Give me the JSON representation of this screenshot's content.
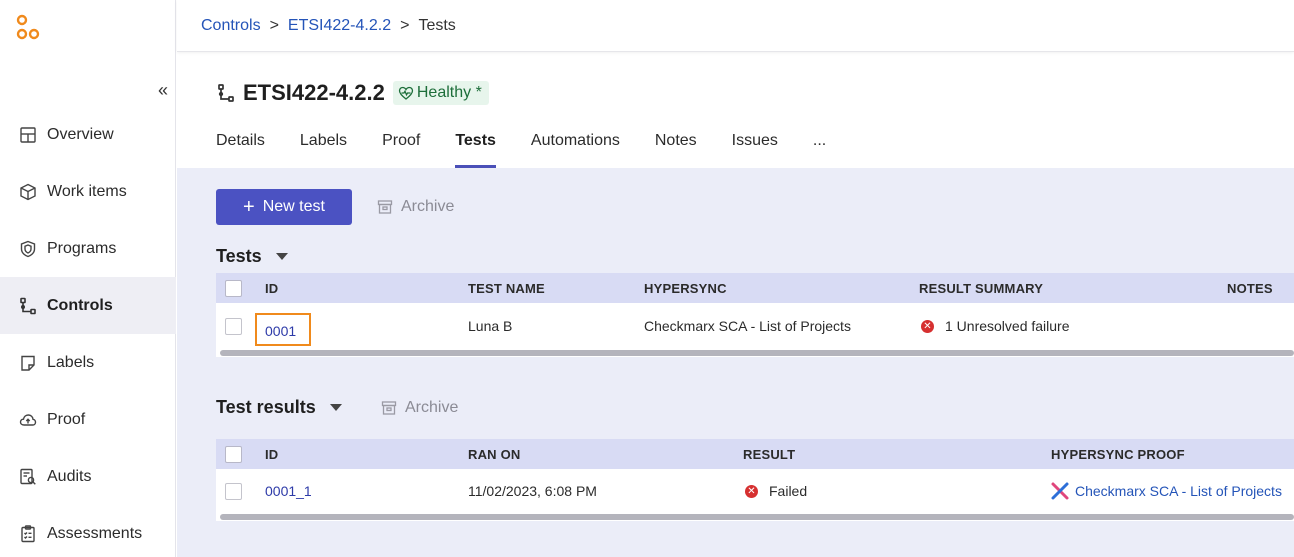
{
  "sidebar": {
    "collapse_label": "«",
    "items": [
      {
        "label": "Overview",
        "icon": "overview-icon"
      },
      {
        "label": "Work items",
        "icon": "box-icon"
      },
      {
        "label": "Programs",
        "icon": "shield-icon"
      },
      {
        "label": "Controls",
        "icon": "controls-icon",
        "active": true
      },
      {
        "label": "Labels",
        "icon": "label-icon"
      },
      {
        "label": "Proof",
        "icon": "cloud-icon"
      },
      {
        "label": "Audits",
        "icon": "audits-icon"
      },
      {
        "label": "Assessments",
        "icon": "clipboard-icon"
      }
    ]
  },
  "breadcrumb": {
    "items": [
      "Controls",
      "ETSI422-4.2.2"
    ],
    "separator": ">",
    "current": "Tests"
  },
  "header": {
    "title": "ETSI422-4.2.2",
    "status": "Healthy *"
  },
  "tabs": [
    "Details",
    "Labels",
    "Proof",
    "Tests",
    "Automations",
    "Notes",
    "Issues",
    "..."
  ],
  "active_tab": "Tests",
  "toolbar": {
    "new_test_label": "New test",
    "archive_label": "Archive"
  },
  "tests": {
    "title": "Tests",
    "archive_label": "Archive",
    "columns": [
      "ID",
      "TEST NAME",
      "HYPERSYNC",
      "RESULT SUMMARY",
      "NOTES"
    ],
    "rows": [
      {
        "id": "0001",
        "test_name": "Luna B",
        "hypersync": "Checkmarx SCA - List of Projects",
        "result_summary": "1 Unresolved failure",
        "notes": ""
      }
    ]
  },
  "test_results": {
    "title": "Test results",
    "archive_label": "Archive",
    "columns": [
      "ID",
      "RAN ON",
      "RESULT",
      "HYPERSYNC PROOF"
    ],
    "rows": [
      {
        "id": "0001_1",
        "ran_on": "11/02/2023, 6:08 PM",
        "result": "Failed",
        "proof": "Checkmarx SCA - List of Projects"
      }
    ]
  },
  "colors": {
    "accent": "#4b52c2",
    "link": "#2454b8",
    "error": "#d63030",
    "healthy_bg": "#e7f5ec",
    "highlight": "#f08a1c"
  }
}
